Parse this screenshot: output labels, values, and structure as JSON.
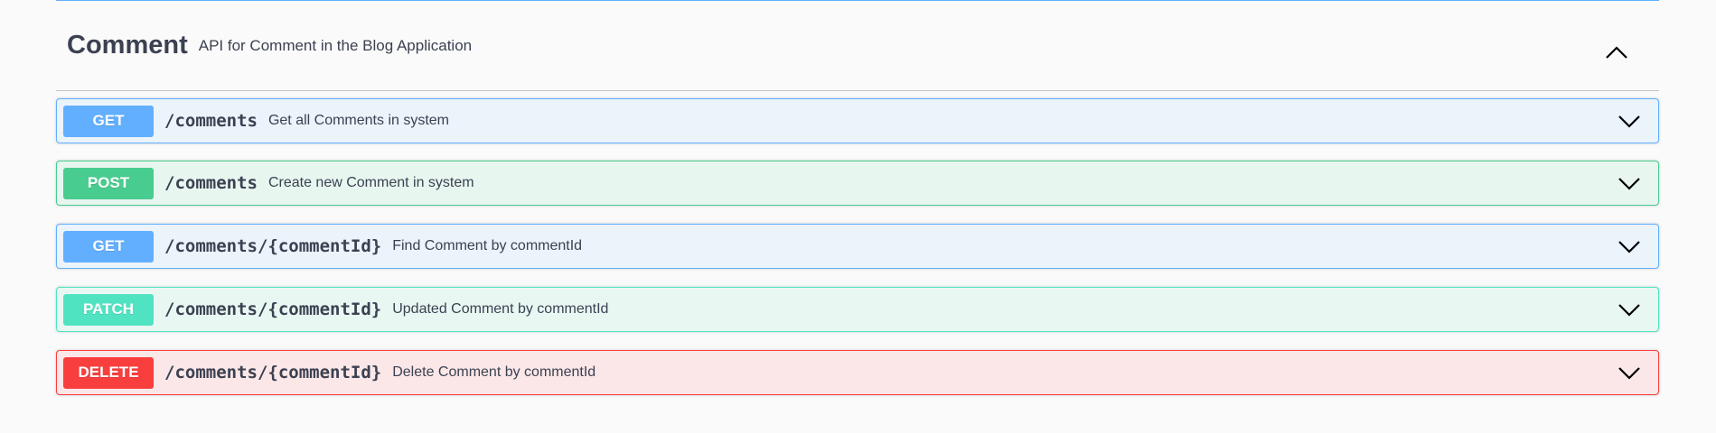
{
  "tag": {
    "name": "Comment",
    "description": "API for Comment in the Blog Application"
  },
  "operations": [
    {
      "method": "GET",
      "path": "/comments",
      "summary": "Get all Comments in system",
      "color": "#61affe",
      "bg": "#ebf3fb"
    },
    {
      "method": "POST",
      "path": "/comments",
      "summary": "Create new Comment in system",
      "color": "#49cc90",
      "bg": "#e8f6f0"
    },
    {
      "method": "GET",
      "path": "/comments/{commentId}",
      "summary": "Find Comment by commentId",
      "color": "#61affe",
      "bg": "#ebf3fb"
    },
    {
      "method": "PATCH",
      "path": "/comments/{commentId}",
      "summary": "Updated Comment by commentId",
      "color": "#50e3c2",
      "bg": "#e9f7f3"
    },
    {
      "method": "DELETE",
      "path": "/comments/{commentId}",
      "summary": "Delete Comment by commentId",
      "color": "#f93e3e",
      "bg": "#fbe7e7"
    }
  ]
}
